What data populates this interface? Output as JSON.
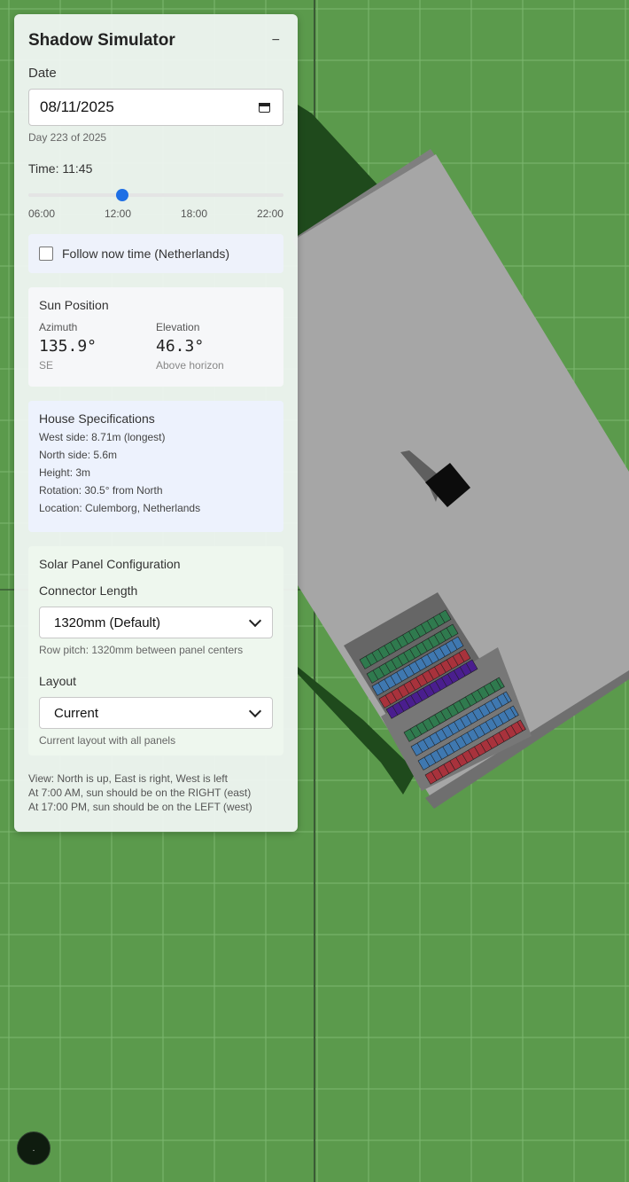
{
  "panel": {
    "title": "Shadow Simulator",
    "minimize_label": "−",
    "date": {
      "label": "Date",
      "value": "08/11/2025",
      "day_info": "Day 223 of 2025"
    },
    "time": {
      "label": "Time: 11:45",
      "slider_fraction": 0.367,
      "ticks": [
        "06:00",
        "12:00",
        "18:00",
        "22:00"
      ]
    },
    "follow": {
      "label": "Follow now time (Netherlands)",
      "checked": false
    },
    "sun": {
      "title": "Sun Position",
      "azimuth_label": "Azimuth",
      "azimuth_value": "135.9°",
      "azimuth_dir": "SE",
      "elevation_label": "Elevation",
      "elevation_value": "46.3°",
      "elevation_note": "Above horizon"
    },
    "house": {
      "title": "House Specifications",
      "specs": [
        "West side: 8.71m (longest)",
        "North side: 5.6m",
        "Height: 3m",
        "Rotation: 30.5° from North",
        "Location: Culemborg, Netherlands"
      ]
    },
    "solar": {
      "title": "Solar Panel Configuration",
      "connector_label": "Connector Length",
      "connector_value": "1320mm (Default)",
      "connector_note": "Row pitch: 1320mm between panel centers",
      "layout_label": "Layout",
      "layout_value": "Current",
      "layout_note": "Current layout with all panels"
    },
    "footer": [
      "View: North is up, East is right, West is left",
      "At 7:00 AM, sun should be on the RIGHT (east)",
      "At 17:00 PM, sun should be on the LEFT (west)"
    ]
  },
  "fab": {
    "label": "."
  },
  "colors": {
    "ground": "#5b9a4c",
    "grid": "#7db870",
    "roof": "#a6a6a6",
    "shadow": "#1f4a1c",
    "panel_green": "#2f7a4e",
    "panel_blue": "#3f78b0",
    "panel_red": "#a8323c",
    "panel_purple": "#4a1e8e",
    "accent": "#1f6fe5"
  }
}
